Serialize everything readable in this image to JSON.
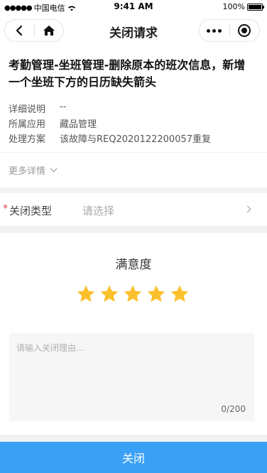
{
  "status_bar": {
    "carrier": "中国电信",
    "time": "9:41 AM",
    "battery": "100%"
  },
  "nav": {
    "title": "关闭请求"
  },
  "request": {
    "title": "考勤管理-坐班管理-删除原本的班次信息，新增一个坐班下方的日历缺失箭头",
    "rows": [
      {
        "key": "详细说明",
        "value": "--"
      },
      {
        "key": "所属应用",
        "value": "藏品管理"
      },
      {
        "key": "处理方案",
        "value": "该故障与REQ2020122200057重复"
      }
    ],
    "more_details": "更多详情"
  },
  "close_type": {
    "label": "关闭类型",
    "placeholder": "请选择"
  },
  "satisfaction": {
    "title": "满意度",
    "rating": 5,
    "max": 5,
    "star_color": "#fbc02d"
  },
  "reason": {
    "placeholder": "请输入关闭理由...",
    "count": "0/200"
  },
  "submit": {
    "label": "关闭",
    "color": "#3aa0f5"
  }
}
